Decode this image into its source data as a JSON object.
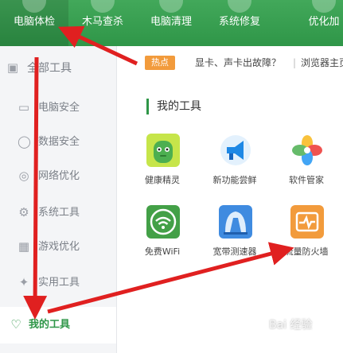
{
  "topnav": {
    "items": [
      {
        "label": "电脑体检"
      },
      {
        "label": "木马查杀"
      },
      {
        "label": "电脑清理"
      },
      {
        "label": "系统修复"
      },
      {
        "label": "优化加"
      }
    ]
  },
  "sidebar": {
    "items": [
      {
        "label": "全部工具",
        "icon": "toolbox-icon"
      },
      {
        "label": "电脑安全",
        "icon": "monitor-icon"
      },
      {
        "label": "数据安全",
        "icon": "shield-icon"
      },
      {
        "label": "网络优化",
        "icon": "globe-icon"
      },
      {
        "label": "系统工具",
        "icon": "gear-icon"
      },
      {
        "label": "游戏优化",
        "icon": "gamepad-icon"
      },
      {
        "label": "实用工具",
        "icon": "wrench-icon"
      },
      {
        "label": "我的工具",
        "icon": "heart-icon"
      }
    ]
  },
  "news": {
    "badge": "热点",
    "text": "显卡、声卡出故障？",
    "separator": "|",
    "text2": "浏览器主页"
  },
  "section": {
    "title": "我的工具"
  },
  "tools": [
    {
      "label": "健康精灵",
      "icon": "green-robot-icon",
      "color": "#8cc63e"
    },
    {
      "label": "新功能尝鲜",
      "icon": "megaphone-icon",
      "color": "#1e88e5"
    },
    {
      "label": "软件管家",
      "icon": "colorful-box-icon",
      "color": "#f2a33a"
    },
    {
      "label": "免费WiFi",
      "icon": "wifi-icon",
      "color": "#43a047"
    },
    {
      "label": "宽带测速器",
      "icon": "speedometer-icon",
      "color": "#3f8be0"
    },
    {
      "label": "流量防火墙",
      "icon": "pulse-icon",
      "color": "#f29b3c"
    }
  ],
  "watermark": "Bai 经验",
  "colors": {
    "accent": "#2f9648",
    "arrow": "#e02020"
  }
}
